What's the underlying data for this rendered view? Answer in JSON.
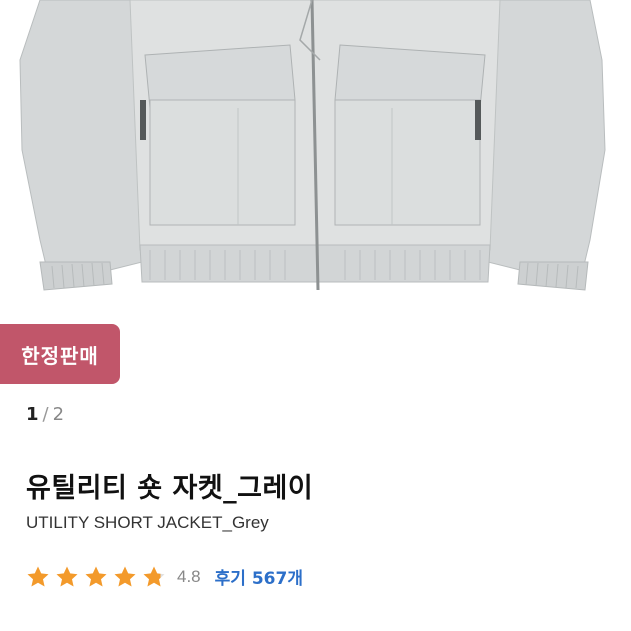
{
  "product": {
    "badge": "한정판매",
    "pager": {
      "current": "1",
      "separator": "/",
      "total": "2"
    },
    "title": "유틸리티 숏 자켓_그레이",
    "subtitle": "UTILITY SHORT JACKET_Grey",
    "rating": {
      "score": "4.8",
      "stars": 4.8,
      "reviews_label": "후기 567개"
    }
  },
  "colors": {
    "badge": "#c1566a",
    "star": "#f39a2b",
    "link": "#2c6fc9",
    "jacket": "#d9dcdc"
  }
}
